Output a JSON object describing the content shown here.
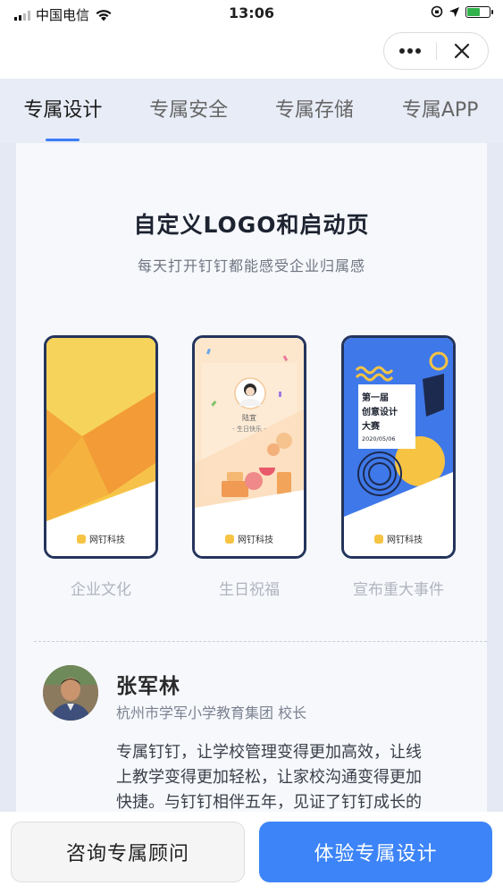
{
  "status_bar": {
    "carrier": "中国电信",
    "time": "13:06"
  },
  "tabs": [
    {
      "label": "专属设计",
      "active": true
    },
    {
      "label": "专属安全",
      "active": false
    },
    {
      "label": "专属存储",
      "active": false
    },
    {
      "label": "专属APP",
      "active": false
    }
  ],
  "hero": {
    "title": "自定义LOGO和启动页",
    "subtitle": "每天打开钉钉都能感受企业归属感"
  },
  "phones": [
    {
      "caption": "企业文化",
      "brand": "网钉科技"
    },
    {
      "caption": "生日祝福",
      "brand": "网钉科技",
      "person_name": "陆宜",
      "greeting": "- 生日快乐 -"
    },
    {
      "caption": "宣布重大事件",
      "brand": "网钉科技",
      "poster_lines": [
        "第一届",
        "创意设计",
        "大赛"
      ],
      "poster_date": "2020/05/06"
    }
  ],
  "testimonial": {
    "name": "张军林",
    "title": "杭州市学军小学教育集团 校长",
    "quote_lines": [
      "专属钉钉，让学校管理变得更加高效，让线",
      "上教学变得更加轻松，让家校沟通变得更加",
      "快捷。与钉钉相伴五年，见证了钉钉成长的"
    ]
  },
  "actions": {
    "consult_label": "咨询专属顾问",
    "try_label": "体验专属设计"
  },
  "colors": {
    "accent": "#3c84f7",
    "tab_bg": "#e8ecf6",
    "phone_border": "#24345c"
  }
}
